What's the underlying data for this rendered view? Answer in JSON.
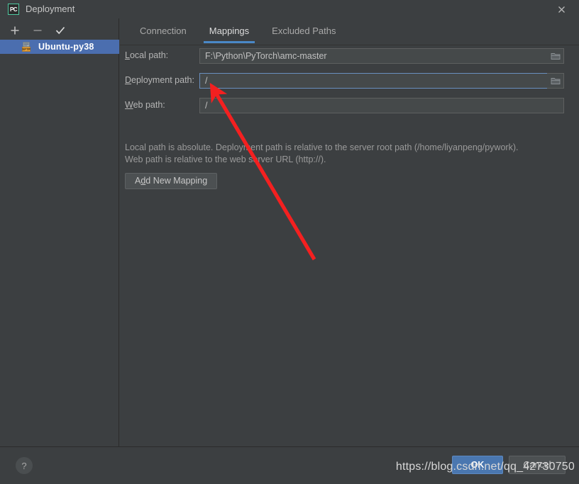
{
  "window": {
    "title": "Deployment",
    "logo_text": "PC",
    "logo_icon": "pycharm-logo-icon",
    "close_icon": "close-icon"
  },
  "sidebar": {
    "toolbar": [
      {
        "name": "add-server-button",
        "icon": "plus-icon",
        "label": "+"
      },
      {
        "name": "remove-server-button",
        "icon": "minus-icon",
        "label": "−"
      },
      {
        "name": "set-default-server-button",
        "icon": "check-icon",
        "label": "✓"
      }
    ],
    "items": [
      {
        "label": "Ubuntu-py38",
        "icon": "sftp-server-icon",
        "selected": true
      }
    ]
  },
  "tabs": [
    {
      "label": "Connection",
      "active": false
    },
    {
      "label": "Mappings",
      "active": true
    },
    {
      "label": "Excluded Paths",
      "active": false
    }
  ],
  "form": {
    "rows": [
      {
        "label_pre": "L",
        "label_mnemonic": "",
        "label": "Local path:",
        "label_head": "L",
        "label_tail": "ocal path:",
        "value": "F:\\Python\\PyTorch\\amc-master",
        "placeholder": "",
        "has_browse": true,
        "focused": false
      },
      {
        "label": "Deployment path:",
        "label_head": "D",
        "label_tail": "eployment path:",
        "value": "/",
        "placeholder": "",
        "has_browse": true,
        "focused": true
      },
      {
        "label": "Web path:",
        "label_head": "W",
        "label_tail": "eb path:",
        "value": "/",
        "placeholder": "",
        "has_browse": false,
        "focused": false
      }
    ],
    "help_line1": "Local path is absolute. Deployment path is relative to the server root path (/home/liyanpeng/pywork).",
    "help_line2": "Web path is relative to the web server URL (http://).",
    "add_mapping_head": "A",
    "add_mapping_mnemonic": "d",
    "add_mapping_tail": "d New Mapping",
    "browse_icon": "folder-browse-icon"
  },
  "footer": {
    "help_label": "?",
    "help_icon": "help-icon",
    "ok_label": "OK",
    "cancel_label": "Cancel"
  },
  "annotation": {
    "arrow_color": "#f42020",
    "watermark": "https://blog.csdn.net/qq_42730750"
  },
  "colors": {
    "background": "#3c3f41",
    "selection": "#4b6eaf",
    "accent": "#4a88c7",
    "ok_button": "#4a77b0",
    "field_background": "#45494a"
  }
}
